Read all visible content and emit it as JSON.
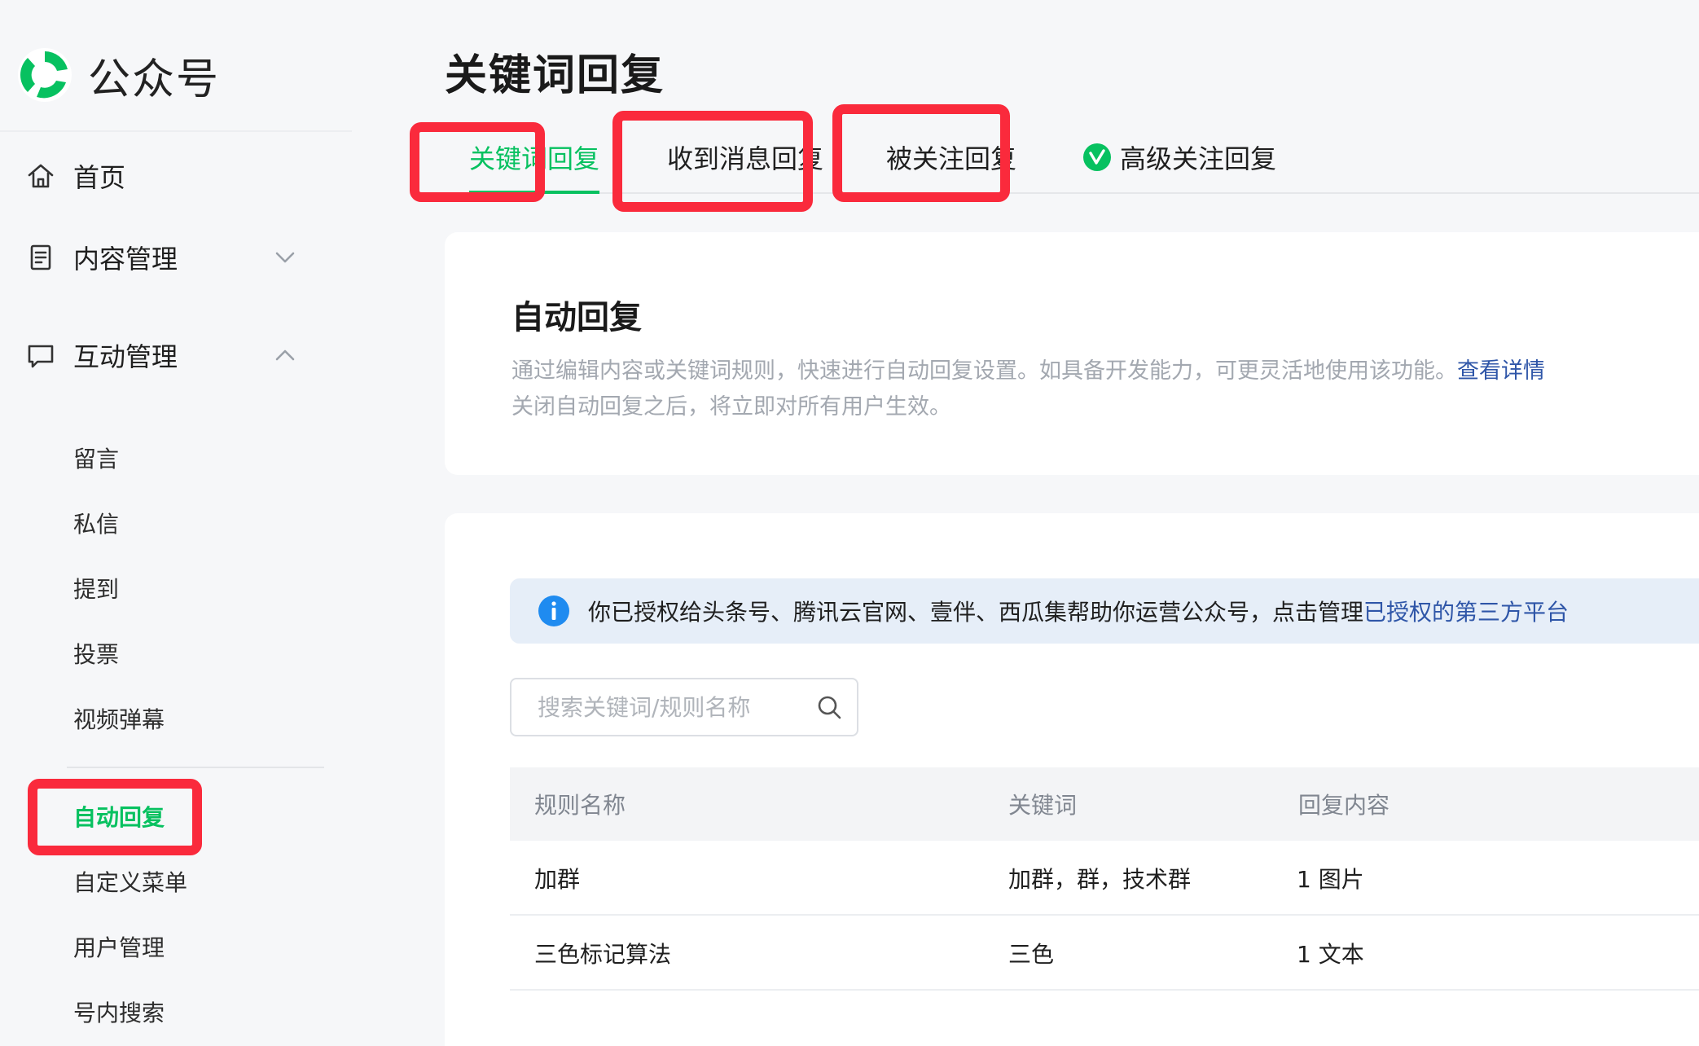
{
  "brand": {
    "name": "公众号",
    "logo_icon": "wechat-official-account-logo-icon",
    "accent": "#07c160"
  },
  "sidebar": {
    "items": [
      {
        "label": "首页",
        "icon": "home-icon"
      },
      {
        "label": "内容管理",
        "icon": "document-icon",
        "expanded": false
      },
      {
        "label": "互动管理",
        "icon": "chat-icon",
        "expanded": true
      }
    ],
    "sub_items_a": [
      "留言",
      "私信",
      "提到",
      "投票",
      "视频弹幕"
    ],
    "sub_items_b": [
      "自动回复",
      "自定义菜单",
      "用户管理",
      "号内搜索"
    ],
    "active_sub_item": "自动回复"
  },
  "main": {
    "title": "关键词回复",
    "tabs": [
      {
        "label": "关键词回复",
        "active": true
      },
      {
        "label": "收到消息回复",
        "active": false
      },
      {
        "label": "被关注回复",
        "active": false
      },
      {
        "label": "高级关注回复",
        "active": false,
        "badge_icon": "verified-badge-icon"
      }
    ],
    "intro": {
      "title": "自动回复",
      "desc_line1": "通过编辑内容或关键词规则，快速进行自动回复设置。如具备开发能力，可更灵活地使用该功能。",
      "desc_link": "查看详情",
      "desc_line2": "关闭自动回复之后，将立即对所有用户生效。"
    },
    "notice": {
      "icon": "info-icon",
      "text": "你已授权给头条号、腾讯云官网、壹伴、西瓜集帮助你运营公众号，点击管理",
      "link": "已授权的第三方平台"
    },
    "search": {
      "placeholder": "搜索关键词/规则名称",
      "value": ""
    },
    "table": {
      "headers": [
        "规则名称",
        "关键词",
        "回复内容"
      ],
      "rows": [
        {
          "name": "加群",
          "keywords": "加群，群，技术群",
          "reply": "1 图片"
        },
        {
          "name": "三色标记算法",
          "keywords": "三色",
          "reply": "1 文本"
        }
      ]
    }
  },
  "colors": {
    "accent_green": "#07c160",
    "highlight_red": "#fa2a3c",
    "link_blue": "#2f56a8",
    "notice_bg": "#e6eef8",
    "info_blue": "#1f8bf0"
  }
}
